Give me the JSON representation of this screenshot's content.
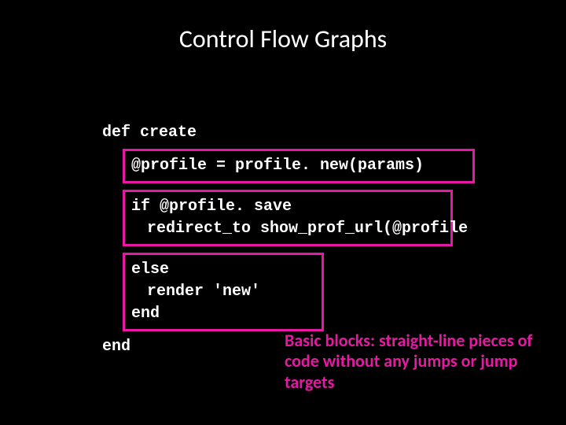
{
  "title": "Control Flow Graphs",
  "code": {
    "def_line": "def create",
    "block1_line1": "@profile = profile. new(params)",
    "block2_line1": "if @profile. save",
    "block2_line2": "redirect_to show_prof_url(@profile",
    "block3_line1": "else",
    "block3_line2": "render 'new'",
    "block3_line3": "end",
    "end_line": "end"
  },
  "callout": "Basic blocks: straight-line pieces of code without any jumps or jump targets"
}
